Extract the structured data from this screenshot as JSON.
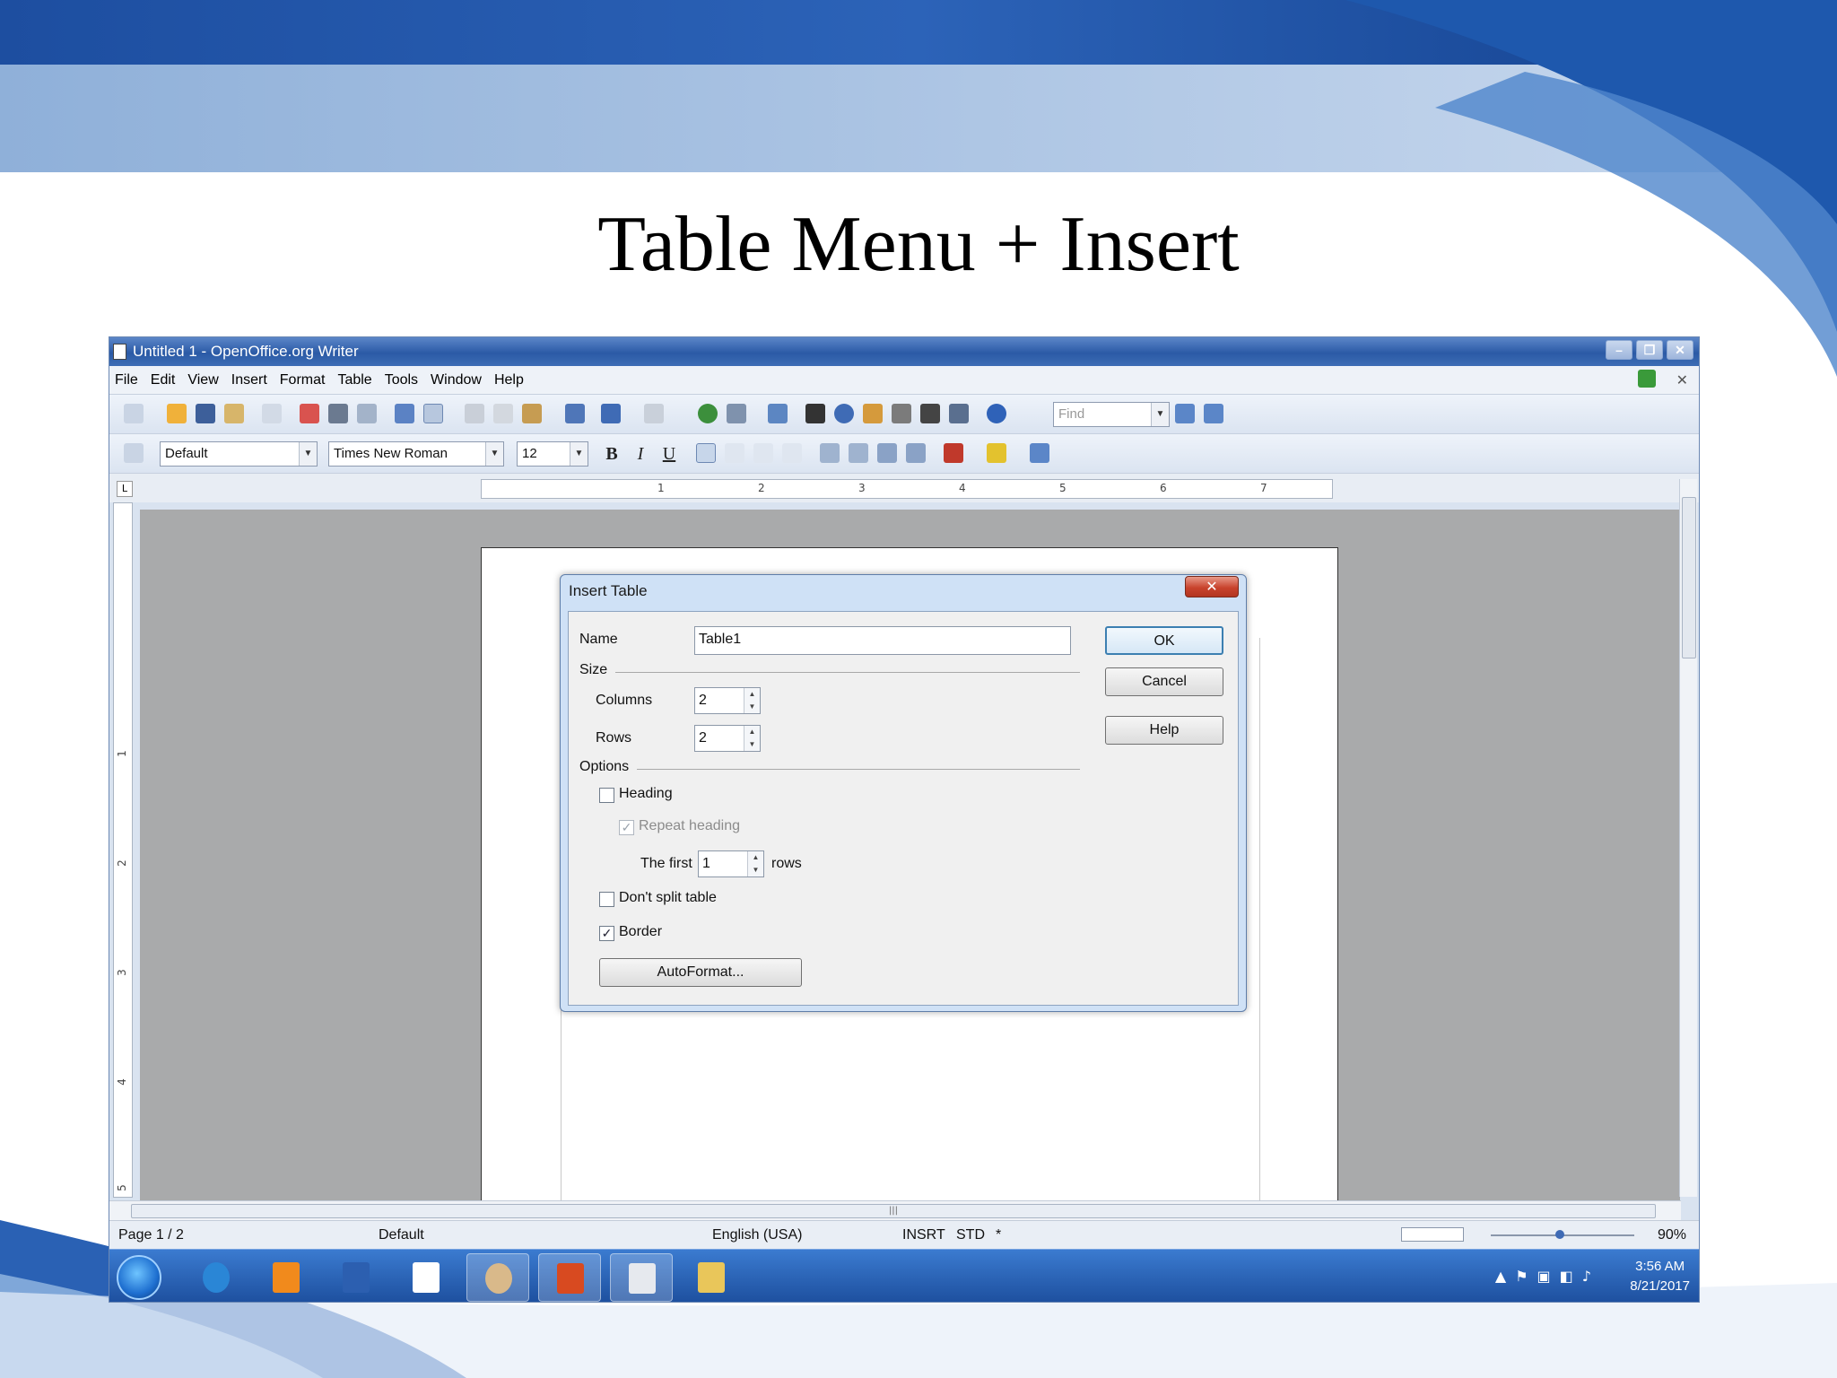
{
  "slide": {
    "title": "Table Menu + Insert"
  },
  "window": {
    "title": "Untitled 1 - OpenOffice.org Writer",
    "minimize": "–",
    "restore": "❐",
    "close": "✕"
  },
  "menubar": {
    "items": [
      "File",
      "Edit",
      "View",
      "Insert",
      "Format",
      "Table",
      "Tools",
      "Window",
      "Help"
    ],
    "close_doc": "✕"
  },
  "toolbar": {
    "find_placeholder": "Find",
    "style": "Default",
    "font": "Times New Roman",
    "size": "12",
    "bold": "B",
    "italic": "I",
    "underline": "U"
  },
  "ruler": {
    "marks": [
      "1",
      "2",
      "3",
      "4",
      "5",
      "6",
      "7"
    ]
  },
  "vruler": {
    "marks": [
      "1",
      "2",
      "3",
      "4",
      "5"
    ]
  },
  "dialog": {
    "title": "Insert Table",
    "close": "✕",
    "name_label": "Name",
    "name_value": "Table1",
    "size_label": "Size",
    "columns_label": "Columns",
    "columns_value": "2",
    "rows_label": "Rows",
    "rows_value": "2",
    "options_label": "Options",
    "heading_label": "Heading",
    "heading_checked": false,
    "repeat_heading_label": "Repeat heading",
    "repeat_heading_checked": true,
    "the_first_label": "The first",
    "the_first_value": "1",
    "rows_suffix": "rows",
    "dont_split_label": "Don't split table",
    "dont_split_checked": false,
    "border_label": "Border",
    "border_checked": true,
    "autoformat_label": "AutoFormat...",
    "ok_label": "OK",
    "cancel_label": "Cancel",
    "help_label": "Help"
  },
  "statusbar": {
    "page": "Page 1 / 2",
    "style": "Default",
    "language": "English (USA)",
    "insert_mode": "INSRT",
    "selection_mode": "STD",
    "modified": "*",
    "zoom": "90%"
  },
  "taskbar": {
    "time": "3:56 AM",
    "date": "8/21/2017"
  },
  "colors": {
    "accent": "#2b5aa6",
    "dialog_frame": "#cfe1f6",
    "close_red": "#c8432d"
  }
}
